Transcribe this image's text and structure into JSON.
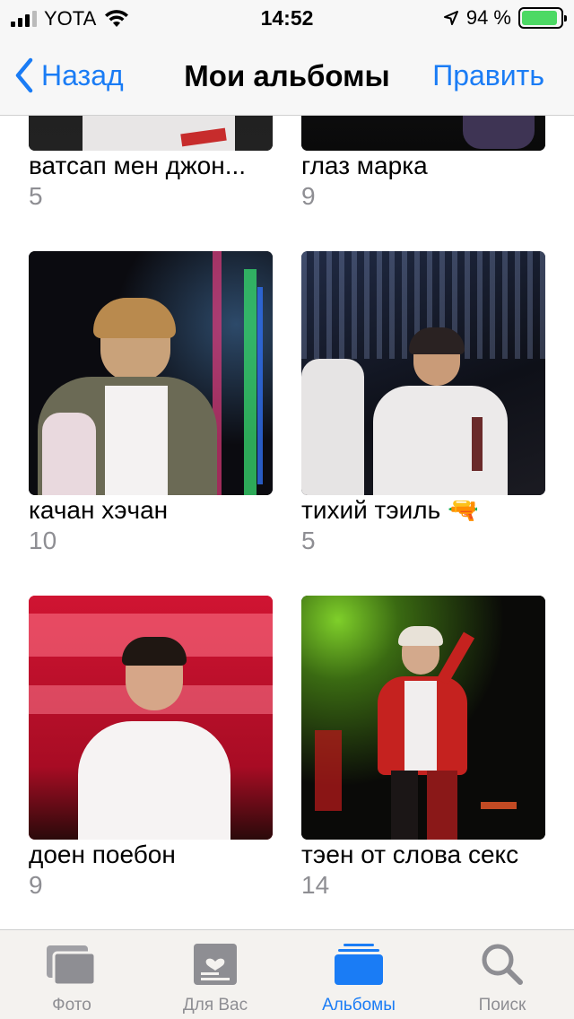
{
  "status_bar": {
    "carrier": "YOTA",
    "time": "14:52",
    "battery_percent": "94 %",
    "battery_level": 0.94
  },
  "nav": {
    "back_label": "Назад",
    "title": "Мои альбомы",
    "edit_label": "Править"
  },
  "albums": [
    {
      "name": "ватсап мен джон...",
      "count": "5"
    },
    {
      "name": "глаз марка",
      "count": "9"
    },
    {
      "name": "качан хэчан",
      "count": "10"
    },
    {
      "name": "тихий тэиль 🔫",
      "count": "5"
    },
    {
      "name": "доен поебон",
      "count": "9"
    },
    {
      "name": "тэен от слова секс",
      "count": "14"
    }
  ],
  "tabs": [
    {
      "label": "Фото",
      "icon": "photos-icon",
      "active": false
    },
    {
      "label": "Для Вас",
      "icon": "for-you-icon",
      "active": false
    },
    {
      "label": "Альбомы",
      "icon": "albums-icon",
      "active": true
    },
    {
      "label": "Поиск",
      "icon": "search-icon",
      "active": false
    }
  ],
  "colors": {
    "accent": "#1a7cf5",
    "battery": "#4cd964",
    "secondary_text": "#8e8e93"
  }
}
